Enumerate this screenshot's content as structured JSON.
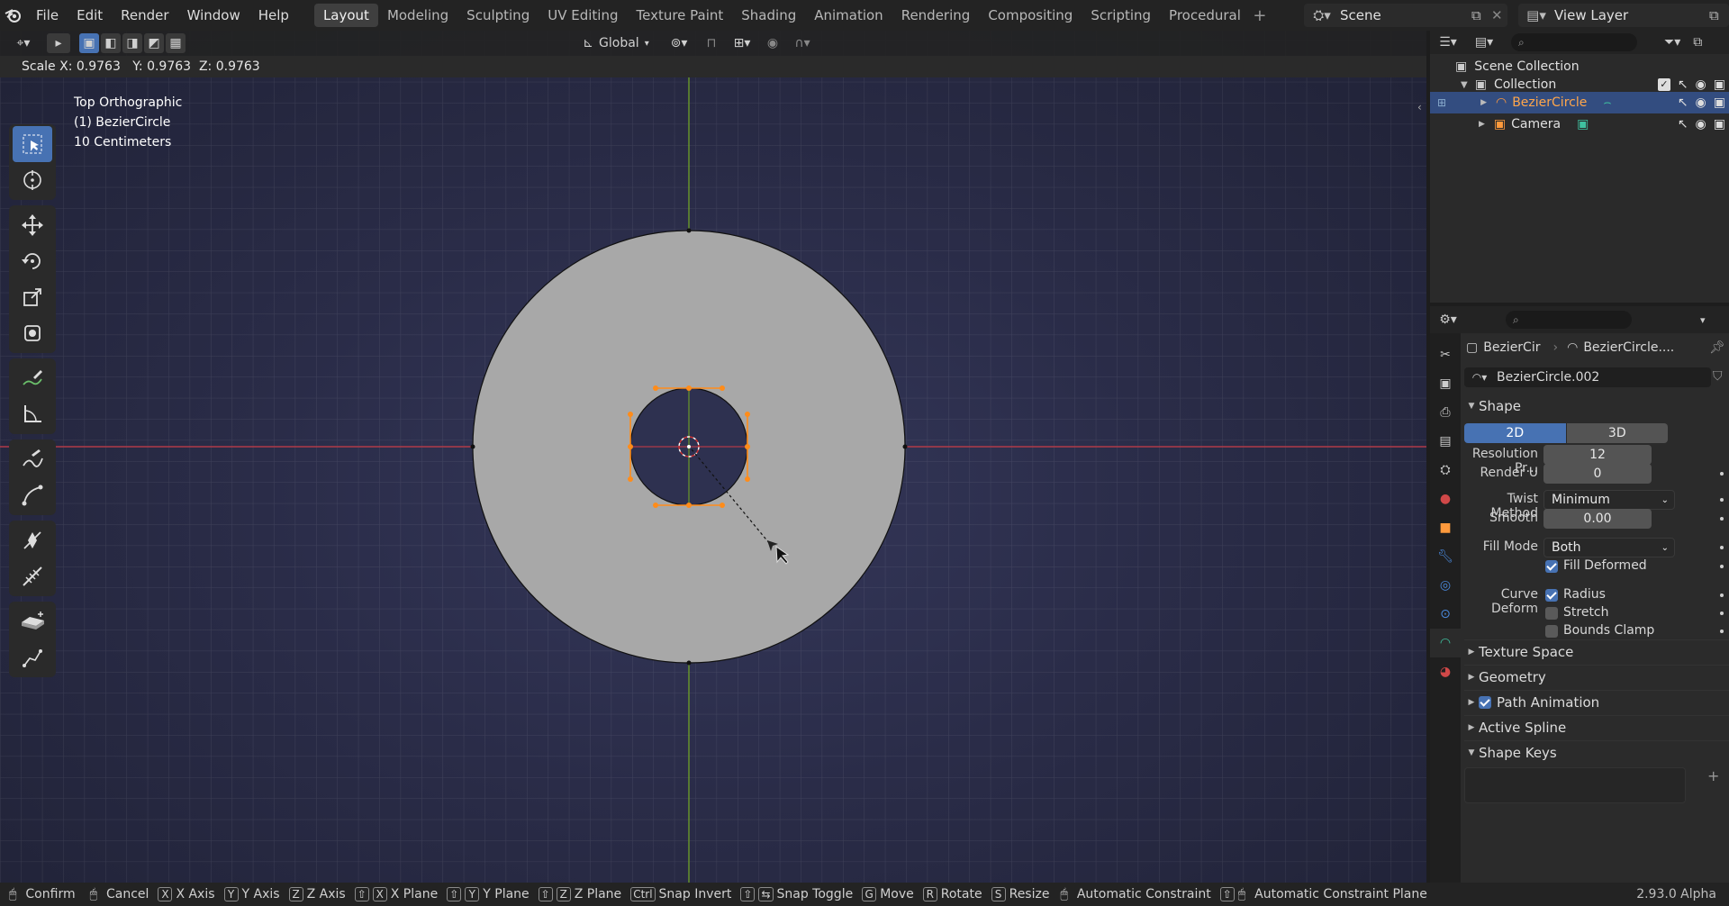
{
  "menu": [
    "File",
    "Edit",
    "Render",
    "Window",
    "Help"
  ],
  "workspace_tabs": [
    {
      "label": "Layout",
      "active": true
    },
    {
      "label": "Modeling"
    },
    {
      "label": "Sculpting"
    },
    {
      "label": "UV Editing"
    },
    {
      "label": "Texture Paint"
    },
    {
      "label": "Shading"
    },
    {
      "label": "Animation"
    },
    {
      "label": "Rendering"
    },
    {
      "label": "Compositing"
    },
    {
      "label": "Scripting"
    },
    {
      "label": "Procedural"
    }
  ],
  "scene": {
    "name": "Scene",
    "view_layer": "View Layer"
  },
  "viewport": {
    "orientation": "Global",
    "scale_readout": "Scale X: 0.9763   Y: 0.9763  Z: 0.9763",
    "view_name": "Top Orthographic",
    "object_label": "(1) BezierCircle",
    "grid_scale": "10 Centimeters",
    "colors": {
      "x_axis": "#b03a48",
      "y_axis": "#6a9a2a",
      "selection": "#ff8c1a",
      "fill": "#a8a8a8"
    }
  },
  "toolbar_icons": [
    "select-box-icon",
    "cursor-icon",
    "move-icon",
    "rotate-icon",
    "scale-icon",
    "transform-icon",
    "annotate-icon",
    "measure-icon",
    "draw-icon",
    "curve-draw-icon",
    "tilt-icon",
    "radius-icon",
    "extrude-icon",
    "randomize-icon"
  ],
  "outliner": {
    "root": "Scene Collection",
    "collection": "Collection",
    "items": [
      {
        "name": "BezierCircle",
        "selected": true
      },
      {
        "name": "Camera",
        "selected": false
      }
    ]
  },
  "properties": {
    "breadcrumb_object": "BezierCir",
    "breadcrumb_data": "BezierCircle....",
    "datablock": "BezierCircle.002",
    "shape_panel": "Shape",
    "dim_2d": "2D",
    "dim_3d": "3D",
    "resolution_label": "Resolution Pr...",
    "resolution_value": "12",
    "render_u_label": "Render U",
    "render_u_value": "0",
    "twist_label": "Twist Method",
    "twist_value": "Minimum",
    "smooth_label": "Smooth",
    "smooth_value": "0.00",
    "fill_mode_label": "Fill Mode",
    "fill_mode_value": "Both",
    "fill_deformed": "Fill Deformed",
    "curve_deform_label": "Curve Deform",
    "radius": "Radius",
    "stretch": "Stretch",
    "bounds_clamp": "Bounds Clamp",
    "panels": [
      "Texture Space",
      "Geometry",
      "Path Animation",
      "Active Spline",
      "Shape Keys"
    ]
  },
  "statusbar": {
    "confirm": "Confirm",
    "cancel": "Cancel",
    "x_axis": "X Axis",
    "y_axis": "Y Axis",
    "z_axis": "Z Axis",
    "x_plane": "X Plane",
    "y_plane": "Y Plane",
    "z_plane": "Z Plane",
    "snap_invert": "Snap Invert",
    "snap_toggle": "Snap Toggle",
    "move": "Move",
    "rotate": "Rotate",
    "resize": "Resize",
    "auto_constraint": "Automatic Constraint",
    "auto_constraint_plane": "Automatic Constraint Plane",
    "keys": {
      "x": "X",
      "y": "Y",
      "z": "Z",
      "shift": "⇧",
      "ctrl": "Ctrl",
      "g": "G",
      "r": "R",
      "s": "S"
    },
    "version": "2.93.0 Alpha"
  }
}
